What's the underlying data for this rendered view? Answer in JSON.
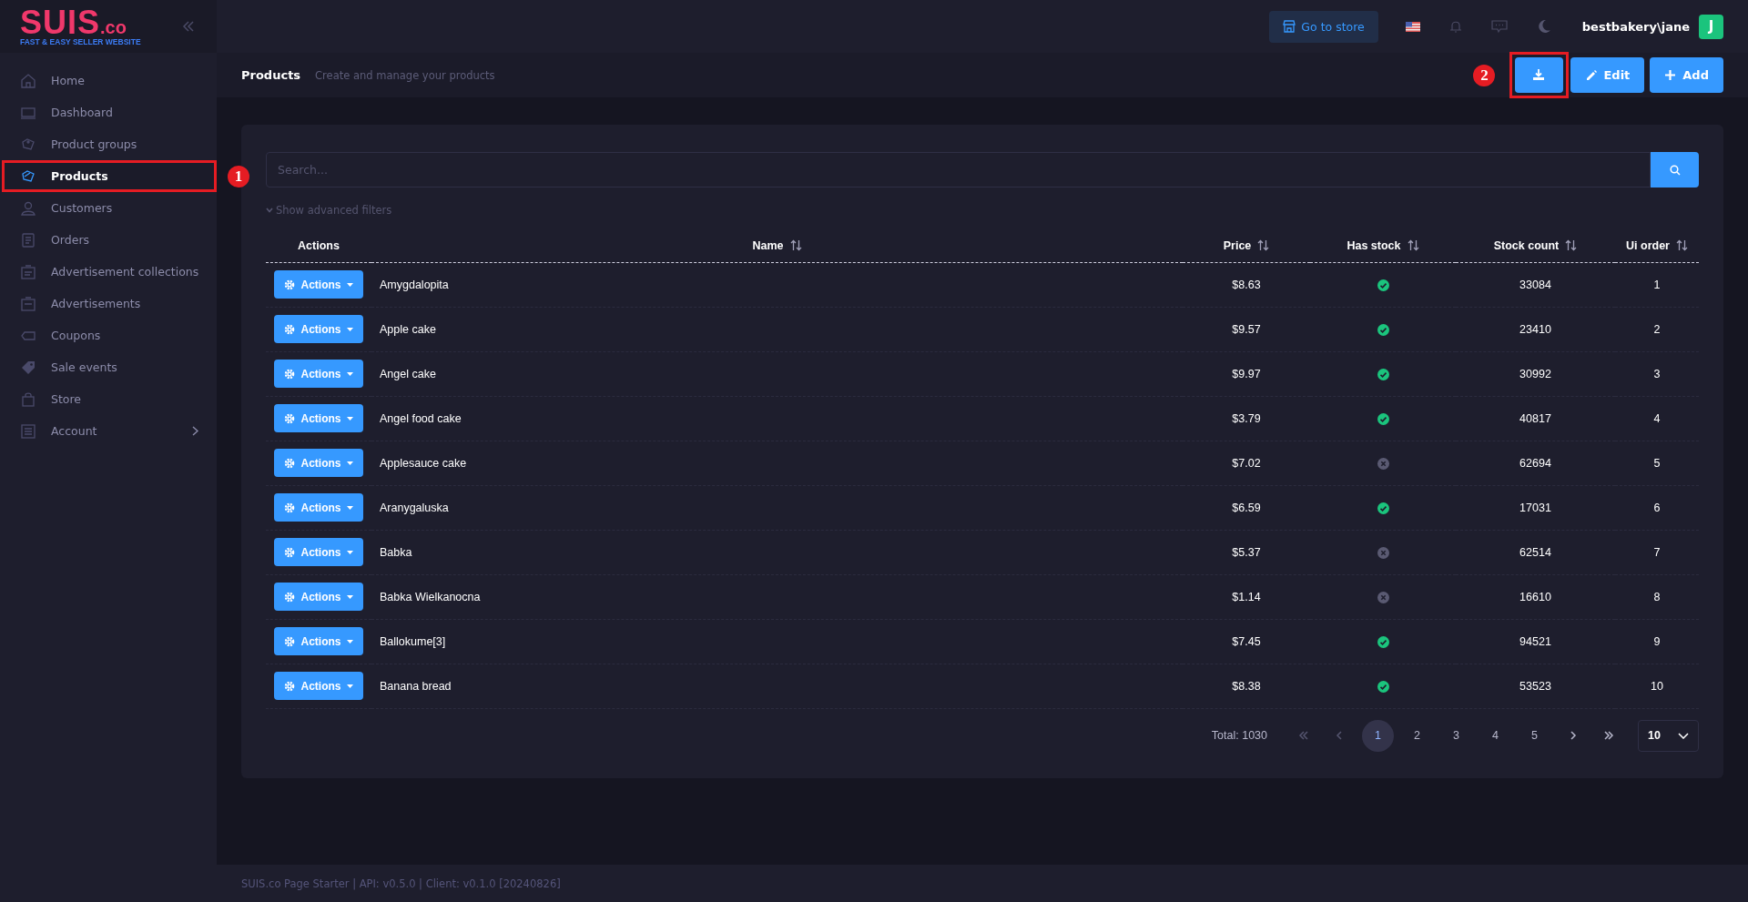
{
  "sidebar": {
    "logo": {
      "title": "SUIS",
      "suffix": ".co",
      "tagline": "FAST & EASY SELLER WEBSITE"
    },
    "items": [
      {
        "label": "Home",
        "selected": false,
        "expandable": false
      },
      {
        "label": "Dashboard",
        "selected": false,
        "expandable": false
      },
      {
        "label": "Product groups",
        "selected": false,
        "expandable": false
      },
      {
        "label": "Products",
        "selected": true,
        "expandable": false,
        "annotation": "1"
      },
      {
        "label": "Customers",
        "selected": false,
        "expandable": false
      },
      {
        "label": "Orders",
        "selected": false,
        "expandable": false
      },
      {
        "label": "Advertisement collections",
        "selected": false,
        "expandable": false
      },
      {
        "label": "Advertisements",
        "selected": false,
        "expandable": false
      },
      {
        "label": "Coupons",
        "selected": false,
        "expandable": false
      },
      {
        "label": "Sale events",
        "selected": false,
        "expandable": false
      },
      {
        "label": "Store",
        "selected": false,
        "expandable": false
      },
      {
        "label": "Account",
        "selected": false,
        "expandable": true
      }
    ]
  },
  "topbar": {
    "store_button": "Go to store",
    "user": "bestbakery\\jane",
    "avatar": "J"
  },
  "page_header": {
    "title": "Products",
    "subtitle": "Create and manage your products",
    "buttons": [
      {
        "kind": "download",
        "annotation": "2"
      },
      {
        "kind": "edit",
        "label": "Edit"
      },
      {
        "kind": "add",
        "label": "Add"
      }
    ]
  },
  "search": {
    "placeholder": "Search..."
  },
  "filters_toggle": "Show advanced filters",
  "table": {
    "columns": [
      {
        "label": "Actions",
        "sortable": false
      },
      {
        "label": "Name",
        "sortable": true
      },
      {
        "label": "Price",
        "sortable": true
      },
      {
        "label": "Has stock",
        "sortable": true
      },
      {
        "label": "Stock count",
        "sortable": true
      },
      {
        "label": "Ui order",
        "sortable": true
      }
    ],
    "rows": [
      {
        "name": "Amygdalopita",
        "price": "$8.63",
        "has_stock": true,
        "stock_count": "33084",
        "ui_order": "1",
        "action_label": "Actions"
      },
      {
        "name": "Apple cake",
        "price": "$9.57",
        "has_stock": true,
        "stock_count": "23410",
        "ui_order": "2",
        "action_label": "Actions"
      },
      {
        "name": "Angel cake",
        "price": "$9.97",
        "has_stock": true,
        "stock_count": "30992",
        "ui_order": "3",
        "action_label": "Actions"
      },
      {
        "name": "Angel food cake",
        "price": "$3.79",
        "has_stock": true,
        "stock_count": "40817",
        "ui_order": "4",
        "action_label": "Actions"
      },
      {
        "name": "Applesauce cake",
        "price": "$7.02",
        "has_stock": false,
        "stock_count": "62694",
        "ui_order": "5",
        "action_label": "Actions"
      },
      {
        "name": "Aranygaluska",
        "price": "$6.59",
        "has_stock": true,
        "stock_count": "17031",
        "ui_order": "6",
        "action_label": "Actions"
      },
      {
        "name": "Babka",
        "price": "$5.37",
        "has_stock": false,
        "stock_count": "62514",
        "ui_order": "7",
        "action_label": "Actions"
      },
      {
        "name": "Babka Wielkanocna",
        "price": "$1.14",
        "has_stock": false,
        "stock_count": "16610",
        "ui_order": "8",
        "action_label": "Actions"
      },
      {
        "name": "Ballokume[3]",
        "price": "$7.45",
        "has_stock": true,
        "stock_count": "94521",
        "ui_order": "9",
        "action_label": "Actions"
      },
      {
        "name": "Banana bread",
        "price": "$8.38",
        "has_stock": true,
        "stock_count": "53523",
        "ui_order": "10",
        "action_label": "Actions"
      }
    ]
  },
  "pagination": {
    "total": "Total: 1030",
    "pages": [
      {
        "label": "1",
        "selected": true
      },
      {
        "label": "2",
        "selected": false
      },
      {
        "label": "3",
        "selected": false
      },
      {
        "label": "4",
        "selected": false
      },
      {
        "label": "5",
        "selected": false
      }
    ],
    "page_size": "10"
  },
  "footer": "SUIS.co Page Starter | API: v0.5.0 | Client: v0.1.0 [20240826]"
}
